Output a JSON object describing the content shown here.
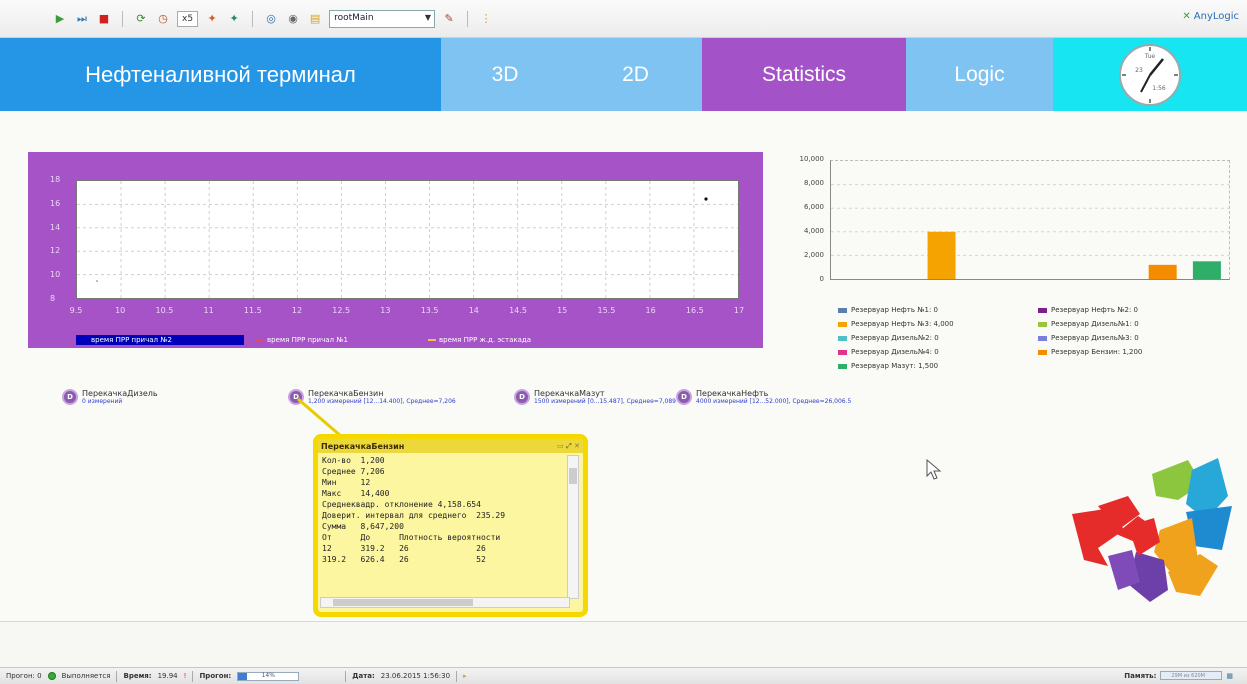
{
  "toolbar": {
    "speed": "x5",
    "view_combo": "rootMain",
    "anylogic_label": "AnyLogic"
  },
  "nav": {
    "title": "Нефтеналивной терминал",
    "tabs": [
      "3D",
      "2D",
      "Statistics",
      "Logic"
    ],
    "clock": {
      "day": "Tue",
      "date": "23",
      "time": "1:56"
    }
  },
  "time_chart": {
    "y_ticks": [
      "18",
      "16",
      "14",
      "12",
      "10",
      "8"
    ],
    "x_ticks": [
      "9.5",
      "10",
      "10.5",
      "11",
      "11.5",
      "12",
      "12.5",
      "13",
      "13.5",
      "14",
      "14.5",
      "15",
      "15.5",
      "16",
      "16.5",
      "17"
    ],
    "legend": [
      "время ПРР причал №2",
      "время ПРР причал №1",
      "время ПРР ж.д. эстакада"
    ],
    "legend_colors": [
      "#0000b8",
      "#e05050",
      "#f2c04c"
    ]
  },
  "chart_data": {
    "type": "bar",
    "y_ticks": [
      "10,000",
      "8,000",
      "6,000",
      "4,000",
      "2,000",
      "0"
    ],
    "ylim": [
      0,
      10000
    ],
    "series": [
      {
        "name": "Резервуар Нефть №1: 0",
        "value": 0,
        "color": "#5a7fa8"
      },
      {
        "name": "Резервуар Нефть №2: 0",
        "value": 0,
        "color": "#7a1f8c"
      },
      {
        "name": "Резервуар Нефть №3: 4,000",
        "value": 4000,
        "color": "#f5a300"
      },
      {
        "name": "Резервуар Дизель№1: 0",
        "value": 0,
        "color": "#9ac43c"
      },
      {
        "name": "Резервуар Дизель№2: 0",
        "value": 0,
        "color": "#4fc0c8"
      },
      {
        "name": "Резервуар Дизель№3: 0",
        "value": 0,
        "color": "#7b7de0"
      },
      {
        "name": "Резервуар Дизель№4: 0",
        "value": 0,
        "color": "#e0348c"
      },
      {
        "name": "Резервуар Бензин: 1,200",
        "value": 1200,
        "color": "#f58c00"
      },
      {
        "name": "Резервуар Мазут: 1,500",
        "value": 1500,
        "color": "#2fae6a"
      }
    ]
  },
  "datasets": [
    {
      "name": "ПерекачкаДизель",
      "sub": "0 измерений"
    },
    {
      "name": "ПерекачкаБензин",
      "sub": "1,200 измерений [12...14.400], Среднее=7,206"
    },
    {
      "name": "ПерекачкаМазут",
      "sub": "1500 измерений [0...15.487], Среднее=7,089"
    },
    {
      "name": "ПерекачкаНефть",
      "sub": "4000 измерений [12...52.000], Среднее=26,006.5"
    }
  ],
  "popup": {
    "title": "ПерекачкаБензин",
    "lines": [
      "Кол-во  1,200",
      "Среднее 7,206",
      "Мин     12",
      "Макс    14,400",
      "Среднеквадр. отклонение 4,158.654",
      "Доверит. интервал для среднего  235.29",
      "Сумма   8,647,200",
      "От      До      Плотность вероятности",
      "12      319.2   26              26",
      "319.2   626.4   26              52"
    ]
  },
  "statusbar": {
    "run_label": "Прогон: 0",
    "state": "Выполняется",
    "time_label": "Время:",
    "time_value": "19.94",
    "progress_label": "Прогон:",
    "progress_pct": "14%",
    "progress_value": 0.14,
    "date_label": "Дата:",
    "date_value": "23.06.2015 1:56:30",
    "memory_label": "Память:",
    "memory_value": "29М из 620М"
  }
}
